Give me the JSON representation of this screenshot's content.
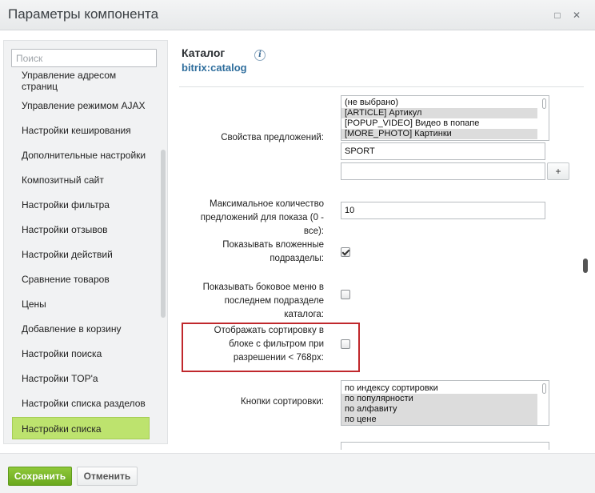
{
  "window": {
    "title": "Параметры компонента",
    "minimize_icon": "□",
    "close_icon": "✕"
  },
  "sidebar": {
    "search_placeholder": "Поиск",
    "items": [
      {
        "label": "Управление адресом страниц"
      },
      {
        "label": "Управление режимом AJAX"
      },
      {
        "label": "Настройки кеширования"
      },
      {
        "label": "Дополнительные настройки"
      },
      {
        "label": "Композитный сайт"
      },
      {
        "label": "Настройки фильтра"
      },
      {
        "label": "Настройки отзывов"
      },
      {
        "label": "Настройки действий"
      },
      {
        "label": "Сравнение товаров"
      },
      {
        "label": "Цены"
      },
      {
        "label": "Добавление в корзину"
      },
      {
        "label": "Настройки поиска"
      },
      {
        "label": "Настройки TOP'a"
      },
      {
        "label": "Настройки списка разделов"
      },
      {
        "label": "Настройки списка"
      }
    ],
    "active_item": "Настройки списка"
  },
  "content": {
    "heading": "Каталог",
    "subheading": "bitrix:catalog",
    "info_icon": "i",
    "fields": {
      "offer_props": {
        "label": "Свойства предложений:",
        "options": [
          {
            "text": "(не выбрано)",
            "selected": false
          },
          {
            "text": "[ARTICLE] Артикул",
            "selected": true
          },
          {
            "text": "[POPUP_VIDEO] Видео в попапе",
            "selected": false
          },
          {
            "text": "[MORE_PHOTO] Картинки",
            "selected": true
          }
        ],
        "extra_value_1": "SPORT",
        "extra_value_2": "",
        "add_button": "+"
      },
      "max_count": {
        "label": "Максимальное количество предложений для показа (0 - все):",
        "value": "10"
      },
      "show_subsections": {
        "label": "Показывать вложенные подразделы:",
        "checked": true
      },
      "show_side_menu": {
        "label": "Показывать боковое меню в последнем подразделе каталога:",
        "checked": false
      },
      "show_sort_in_filter": {
        "label": "Отображать сортировку в блоке с фильтром при разрешении < 768px:",
        "checked": false
      },
      "sort_buttons": {
        "label": "Кнопки сортировки:",
        "options": [
          {
            "text": "по индексу сортировки",
            "selected": false
          },
          {
            "text": "по популярности",
            "selected": true
          },
          {
            "text": "по алфавиту",
            "selected": true
          },
          {
            "text": "по цене",
            "selected": true
          }
        ]
      }
    }
  },
  "footer": {
    "save_label": "Сохранить",
    "cancel_label": "Отменить"
  },
  "colors": {
    "save_button": "#7ab52b",
    "active_sidebar_item": "#bde36e",
    "highlight_border": "#c0282c",
    "subheading_link": "#2f6e9d"
  }
}
